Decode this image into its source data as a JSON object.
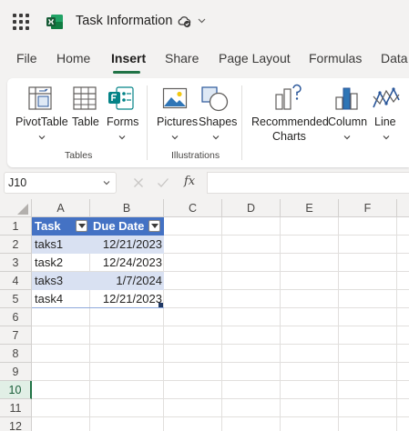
{
  "app": {
    "title": "Task Information",
    "icons": {
      "launcher": "app-launcher-icon",
      "logo": "excel-logo-icon",
      "autosave": "cloud-saved-icon",
      "menu": "chevron-down-icon"
    }
  },
  "menu": {
    "tabs": [
      "File",
      "Home",
      "Insert",
      "Share",
      "Page Layout",
      "Formulas",
      "Data"
    ],
    "active": "Insert"
  },
  "ribbon": {
    "groups": [
      {
        "label": "Tables",
        "buttons": [
          {
            "label": "PivotTable",
            "icon": "pivottable-icon"
          },
          {
            "label": "Table",
            "icon": "table-icon"
          },
          {
            "label": "Forms",
            "icon": "forms-icon"
          }
        ]
      },
      {
        "label": "Illustrations",
        "buttons": [
          {
            "label": "Pictures",
            "icon": "pictures-icon"
          },
          {
            "label": "Shapes",
            "icon": "shapes-icon"
          }
        ]
      },
      {
        "label": "",
        "buttons": [
          {
            "label": "Recommended",
            "label2": "Charts",
            "icon": "recommended-charts-icon"
          },
          {
            "label": "Column",
            "icon": "column-chart-icon"
          },
          {
            "label": "Line",
            "icon": "line-chart-icon"
          }
        ]
      }
    ]
  },
  "formula_bar": {
    "name_box": "J10",
    "fx": "fx",
    "formula": ""
  },
  "sheet": {
    "columns": [
      "A",
      "B",
      "C",
      "D",
      "E",
      "F"
    ],
    "rows": [
      "1",
      "2",
      "3",
      "4",
      "5",
      "6",
      "7",
      "8",
      "9",
      "10",
      "11",
      "12"
    ],
    "selected_row": "10",
    "table": {
      "headers": [
        "Task",
        "Due Date"
      ],
      "rows": [
        [
          "taks1",
          "12/21/2023"
        ],
        [
          "task2",
          "12/24/2023"
        ],
        [
          "taks3",
          "1/7/2024"
        ],
        [
          "task4",
          "12/21/2023"
        ]
      ],
      "header_color": "#4472c4",
      "band_color": "#d9e1f2"
    }
  },
  "colors": {
    "accent": "#217346",
    "background": "#f3f2f1"
  }
}
